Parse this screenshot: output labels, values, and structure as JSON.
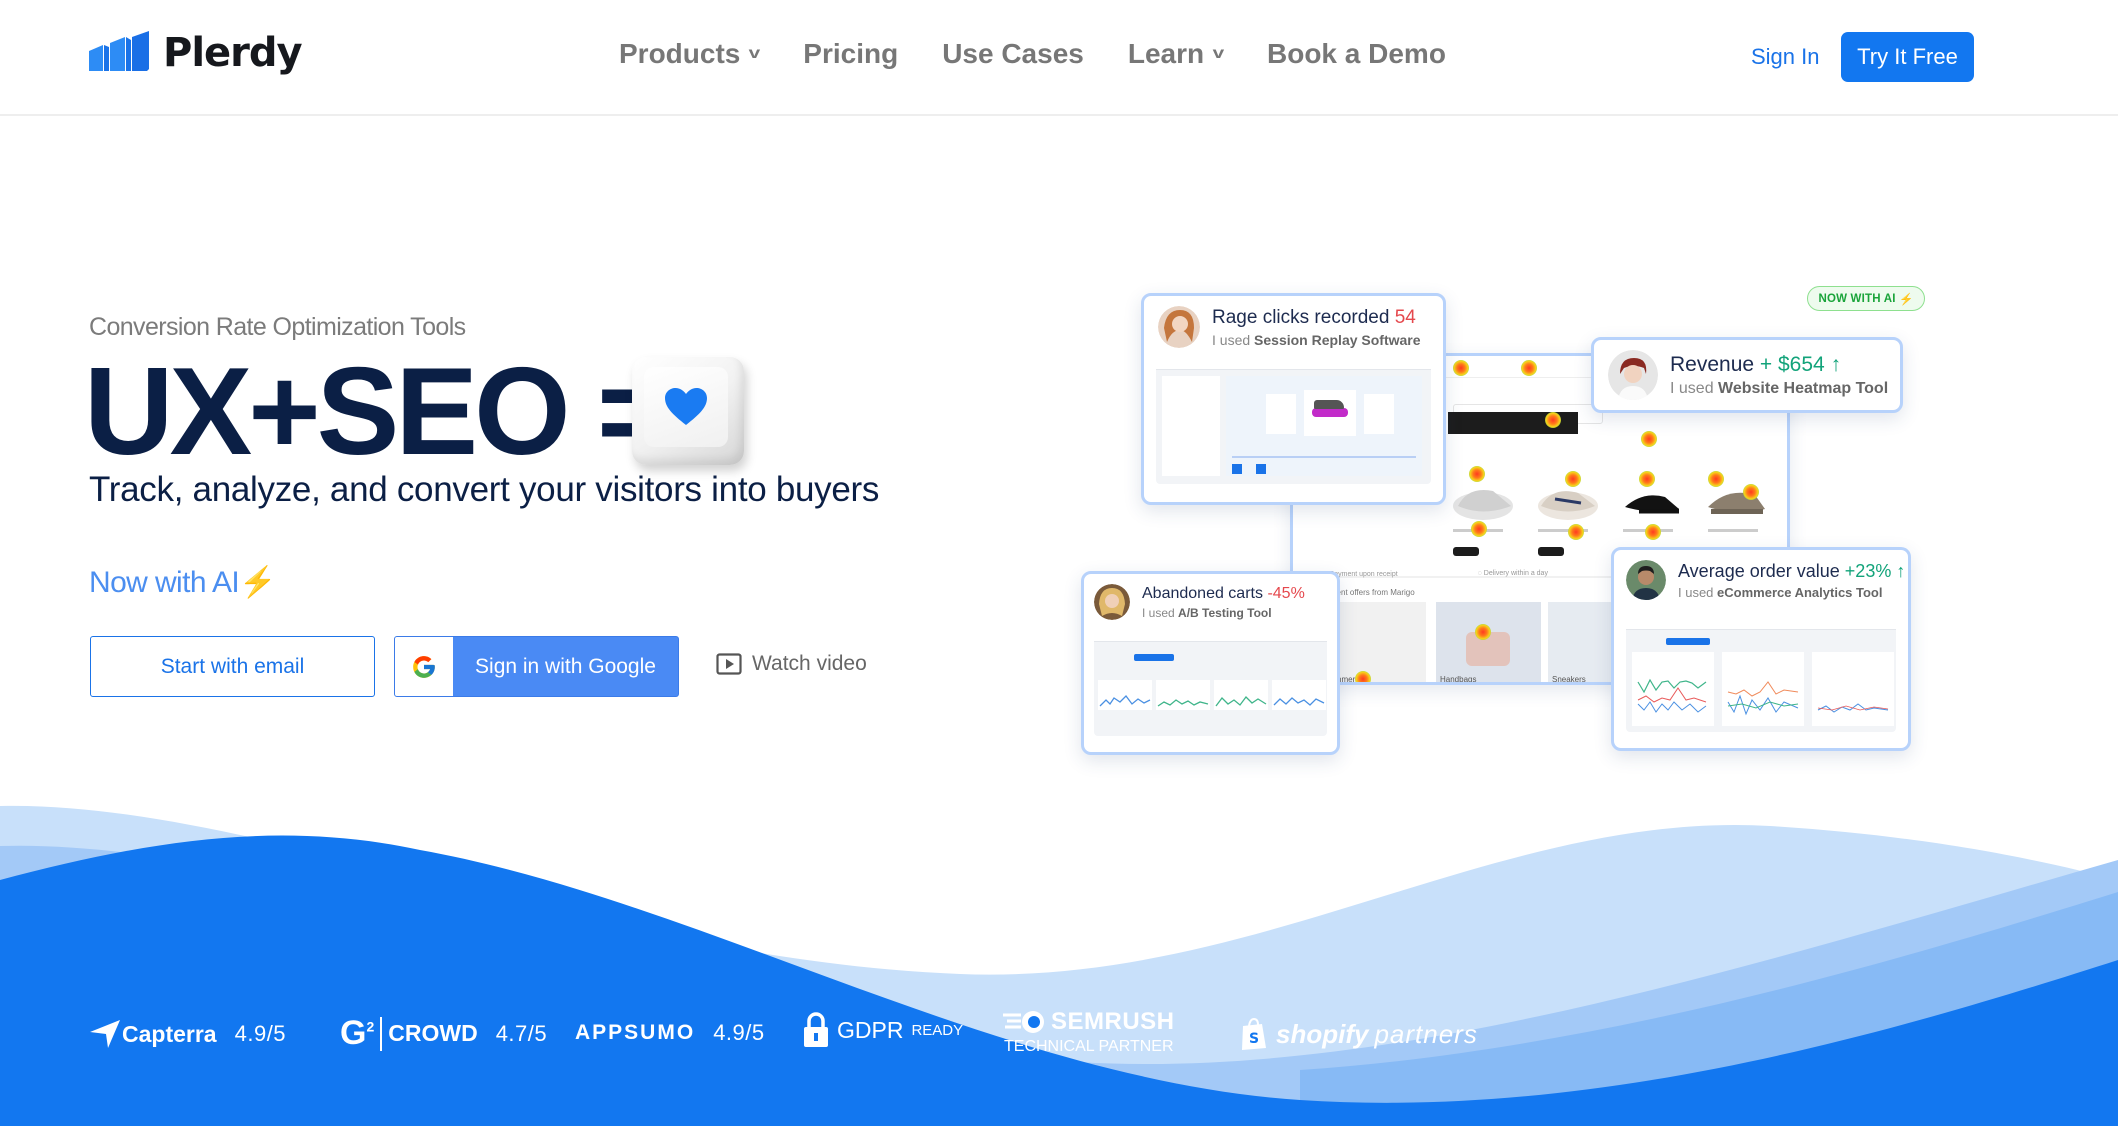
{
  "header": {
    "logo_text": "Plerdy",
    "nav": [
      {
        "label": "Products",
        "has_dropdown": true
      },
      {
        "label": "Pricing",
        "has_dropdown": false
      },
      {
        "label": "Use Cases",
        "has_dropdown": false
      },
      {
        "label": "Learn",
        "has_dropdown": true
      },
      {
        "label": "Book a Demo",
        "has_dropdown": false
      }
    ],
    "sign_in": "Sign In",
    "cta": "Try It Free"
  },
  "hero": {
    "eyebrow": "Conversion Rate Optimization Tools",
    "headline": "UX+SEO =",
    "keycap_icon": "heart-icon",
    "tagline": "Track, analyze, and convert your visitors into buyers",
    "ai_text": "Now with AI",
    "ai_icon": "⚡",
    "buttons": {
      "email": "Start with email",
      "google": "Sign in with Google",
      "video": "Watch video"
    }
  },
  "showcase": {
    "badge": "NOW WITH AI",
    "badge_icon": "⚡",
    "cards": [
      {
        "title": "Rage clicks recorded",
        "metric": "54",
        "metric_tone": "negative",
        "prefix": "I used",
        "tool": "Session Replay Software"
      },
      {
        "title": "Revenue",
        "metric": "+ $654",
        "arrow": "↑",
        "metric_tone": "positive",
        "prefix": "I used",
        "tool": "Website Heatmap Tool"
      },
      {
        "title": "Abandoned carts",
        "metric": "-45%",
        "metric_tone": "negative",
        "prefix": "I used",
        "tool": "A/B Testing Tool"
      },
      {
        "title": "Average order value",
        "metric": "+23%",
        "arrow": "↑",
        "metric_tone": "positive",
        "prefix": "I used",
        "tool": "eCommerce Analytics Tool"
      }
    ],
    "shop_section_title": "Current offers from Marigo",
    "shop_categories": [
      "Summer",
      "Handbags",
      "Sneakers"
    ]
  },
  "partners": [
    {
      "name": "Capterra",
      "rating": "4.9/5"
    },
    {
      "name": "CROWD",
      "prefix": "G2",
      "rating": "4.7/5"
    },
    {
      "name": "APPSUMO",
      "rating": "4.9/5"
    },
    {
      "name": "GDPR",
      "suffix": "READY"
    },
    {
      "name": "SEMRUSH",
      "suffix": "TECHNICAL PARTNER"
    },
    {
      "name": "shopify",
      "suffix": "partners"
    }
  ],
  "colors": {
    "brand_blue": "#1277f0",
    "headline_navy": "#0b1f45",
    "nav_gray": "#777777",
    "google_blue": "#4a8af4",
    "negative": "#e5484d",
    "positive": "#12a37a"
  }
}
